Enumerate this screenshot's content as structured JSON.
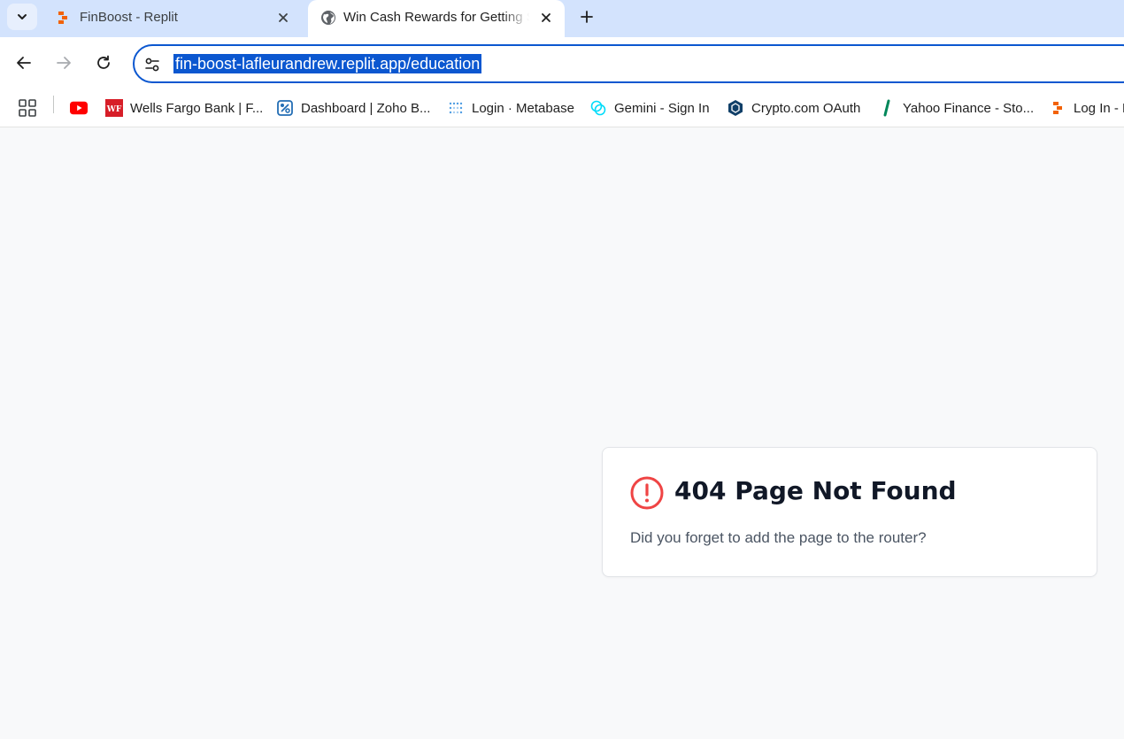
{
  "tabs": [
    {
      "title": "FinBoost - Replit",
      "favicon": "replit-icon",
      "active": false
    },
    {
      "title": "Win Cash Rewards for Getting Smarter",
      "favicon": "globe-icon",
      "active": true
    }
  ],
  "toolbar": {
    "url": "fin-boost-lafleurandrew.replit.app/education"
  },
  "bookmarks": [
    {
      "label": "",
      "icon": "youtube-icon"
    },
    {
      "label": "Wells Fargo Bank | F...",
      "icon": "wells-fargo-icon"
    },
    {
      "label": "Dashboard | Zoho B...",
      "icon": "zoho-books-icon"
    },
    {
      "label": "Login · Metabase",
      "icon": "metabase-icon"
    },
    {
      "label": "Gemini - Sign In",
      "icon": "gemini-icon"
    },
    {
      "label": "Crypto.com OAuth",
      "icon": "crypto-com-icon"
    },
    {
      "label": "Yahoo Finance - Sto...",
      "icon": "yahoo-finance-icon"
    },
    {
      "label": "Log In - Replit",
      "icon": "replit-icon"
    }
  ],
  "page": {
    "heading": "404 Page Not Found",
    "message": "Did you forget to add the page to the router?"
  },
  "colors": {
    "accent": "#0b57d0",
    "error": "#ef4444",
    "tabstrip": "#d3e3fd",
    "page_bg": "#f8f9fa"
  }
}
